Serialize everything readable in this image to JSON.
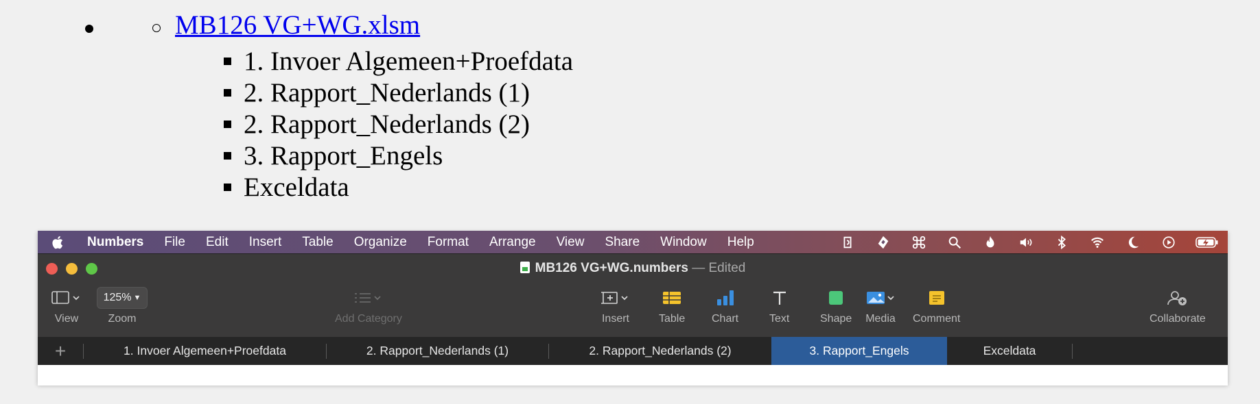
{
  "outline": {
    "file_link": "MB126 VG+WG.xlsm",
    "sheets": [
      "1. Invoer Algemeen+Proefdata",
      "2. Rapport_Nederlands (1)",
      "2. Rapport_Nederlands (2)",
      "3. Rapport_Engels",
      "Exceldata"
    ]
  },
  "menubar": {
    "app_name": "Numbers",
    "items": [
      "File",
      "Edit",
      "Insert",
      "Table",
      "Organize",
      "Format",
      "Arrange",
      "View",
      "Share",
      "Window",
      "Help"
    ],
    "status_icons": [
      "clipboard-icon",
      "cloud-sync-icon",
      "command-icon",
      "spotlight-search-icon",
      "flame-icon",
      "volume-icon",
      "bluetooth-icon",
      "wifi-icon",
      "moon-icon",
      "play-circle-icon",
      "battery-charging-icon"
    ]
  },
  "window": {
    "doc_name": "MB126 VG+WG.numbers",
    "separator": "—",
    "doc_status": "Edited",
    "traffic_colors": {
      "close": "#ee5e56",
      "minimize": "#f5bd3c",
      "zoom": "#5fc748"
    }
  },
  "toolbar": {
    "view_label": "View",
    "zoom_value": "125%",
    "zoom_label": "Zoom",
    "add_category_label": "Add Category",
    "insert_label": "Insert",
    "table_label": "Table",
    "chart_label": "Chart",
    "text_label": "Text",
    "shape_label": "Shape",
    "media_label": "Media",
    "comment_label": "Comment",
    "collaborate_label": "Collaborate"
  },
  "tabs": {
    "add": "+",
    "items": [
      {
        "label": "1. Invoer Algemeen+Proefdata",
        "active": false
      },
      {
        "label": "2. Rapport_Nederlands (1)",
        "active": false
      },
      {
        "label": "2. Rapport_Nederlands (2)",
        "active": false
      },
      {
        "label": "3. Rapport_Engels",
        "active": true
      },
      {
        "label": "Exceldata",
        "active": false
      }
    ],
    "active_color": "#2c5c99"
  }
}
